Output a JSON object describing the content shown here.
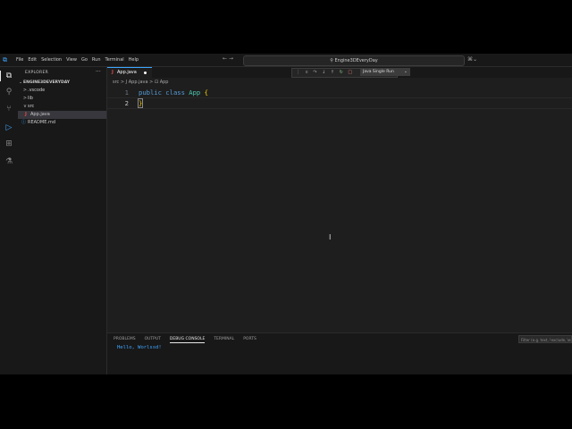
{
  "menu": [
    "File",
    "Edit",
    "Selection",
    "View",
    "Go",
    "Run",
    "Terminal",
    "Help"
  ],
  "command_center": "Engine3DEveryDay",
  "sidebar": {
    "title": "EXPLORER",
    "more": "···",
    "root": "ENGINE3DEVERYDAY",
    "items": [
      {
        "label": ".vscode",
        "chev": ">"
      },
      {
        "label": "lib",
        "chev": ">"
      },
      {
        "label": "src",
        "chev": "v"
      },
      {
        "label": "App.java",
        "icon": "J"
      },
      {
        "label": "README.md",
        "icon": "ⓘ"
      }
    ]
  },
  "editor": {
    "tab_label": "App.java",
    "breadcrumb": "src > J App.java > ⊡ App",
    "run_config": "Java Single Run",
    "lines": [
      {
        "num": "1",
        "kw1": "public",
        "kw2": "class",
        "cls": "App",
        "brace": "{"
      },
      {
        "num": "2",
        "brace": "}"
      }
    ]
  },
  "panel": {
    "tabs": [
      "PROBLEMS",
      "OUTPUT",
      "DEBUG CONSOLE",
      "TERMINAL",
      "PORTS"
    ],
    "active_tab": "DEBUG CONSOLE",
    "filter_placeholder": "Filter (e.g. text, !exclude, \\escape)",
    "output": "Hello, Worlssd!"
  },
  "colors": {
    "accent": "#3ea6ff",
    "keyword": "#569cd6",
    "class": "#4ec9b0",
    "brace": "#ffd700"
  }
}
